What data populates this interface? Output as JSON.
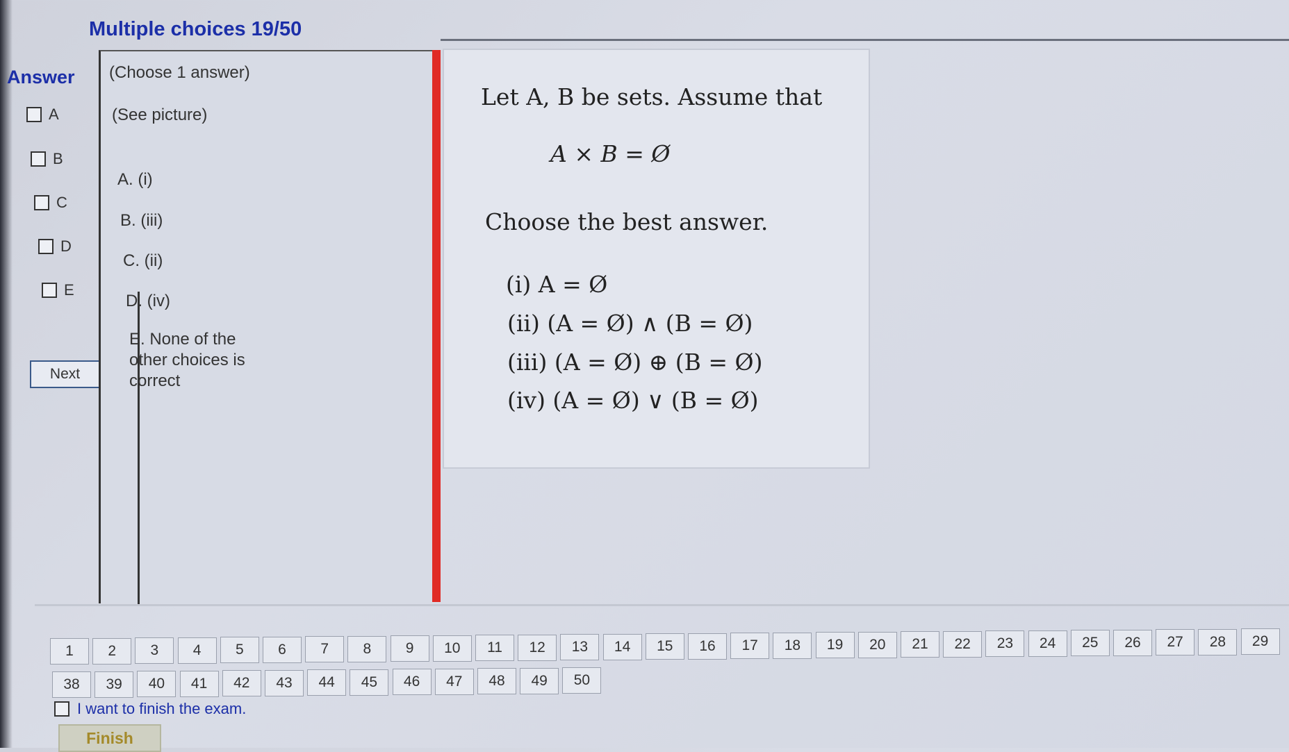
{
  "header": {
    "title": "Multiple choices 19/50"
  },
  "answer": {
    "heading": "Answer",
    "options": [
      "A",
      "B",
      "C",
      "D",
      "E"
    ],
    "next_label": "Next"
  },
  "choices": {
    "instruction": "(Choose 1 answer)",
    "see_picture": "(See picture)",
    "a": "A.  (i)",
    "b": "B.  (iii)",
    "c": "C.  (ii)",
    "d": "D.  (iv)",
    "e_line1": "E.  None of the",
    "e_line2": "other choices is",
    "e_line3": "correct"
  },
  "question": {
    "intro": "Let A, B be sets. Assume that",
    "equation": "A × B = Ø",
    "prompt": "Choose the best answer.",
    "items": [
      "(i)    A = Ø",
      "(ii) (A = Ø) ∧ (B = Ø)",
      "(iii) (A = Ø) ⊕ (B = Ø)",
      "(iv) (A = Ø) ∨ (B = Ø)"
    ]
  },
  "pager": {
    "row1": [
      "1",
      "2",
      "3",
      "4",
      "5",
      "6",
      "7",
      "8",
      "9",
      "10",
      "11",
      "12",
      "13",
      "14",
      "15",
      "16",
      "17",
      "18",
      "19",
      "20",
      "21",
      "22",
      "23",
      "24",
      "25",
      "26",
      "27",
      "28",
      "29"
    ],
    "row2": [
      "38",
      "39",
      "40",
      "41",
      "42",
      "43",
      "44",
      "45",
      "46",
      "47",
      "48",
      "49",
      "50"
    ]
  },
  "finish": {
    "checkbox_label": "I want to finish the exam.",
    "button_label": "Finish"
  }
}
